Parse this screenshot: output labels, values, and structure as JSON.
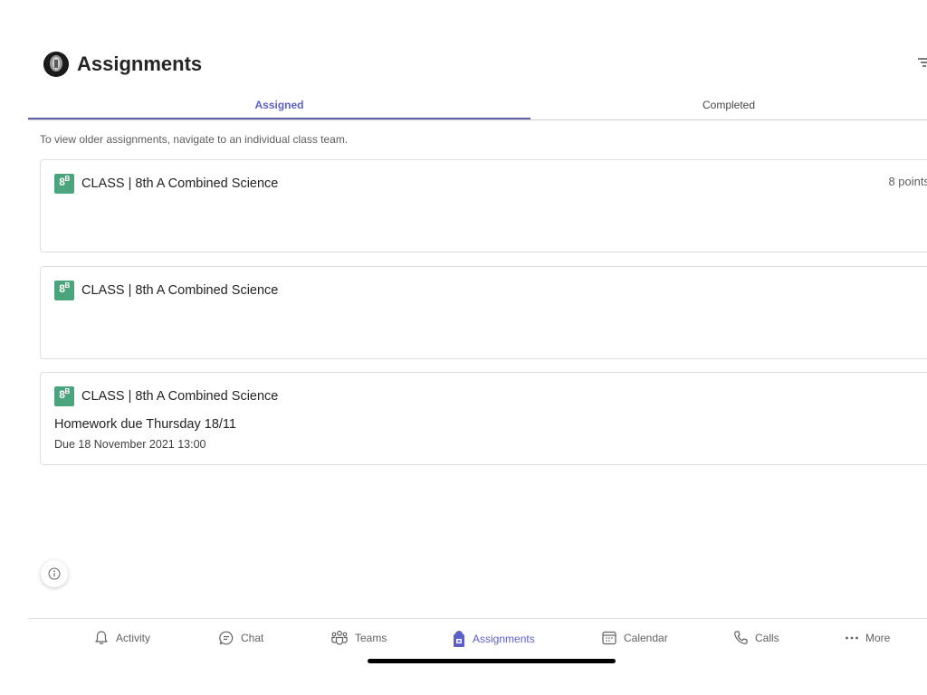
{
  "header": {
    "title": "Assignments"
  },
  "tabs": {
    "assigned": "Assigned",
    "completed": "Completed"
  },
  "info_text": "To view older assignments, navigate to an individual class team.",
  "badge_label": "8",
  "badge_sup": "B",
  "cards": [
    {
      "class_name": "CLASS | 8th A Combined Science",
      "points": "8 points"
    },
    {
      "class_name": "CLASS | 8th A Combined Science"
    },
    {
      "class_name": "CLASS | 8th A Combined Science",
      "title": "Homework due Thursday 18/11",
      "due": "Due 18 November 2021 13:00"
    }
  ],
  "nav": {
    "activity": "Activity",
    "chat": "Chat",
    "teams": "Teams",
    "assignments": "Assignments",
    "calendar": "Calendar",
    "calls": "Calls",
    "more": "More"
  },
  "colors": {
    "accent": "#5b5fc7",
    "badge": "#4aa47c"
  },
  "icons": [
    "avatar",
    "filter-icon",
    "info-icon",
    "bell-icon",
    "chat-icon",
    "teams-icon",
    "assignments-icon",
    "calendar-icon",
    "phone-icon",
    "more-icon"
  ]
}
